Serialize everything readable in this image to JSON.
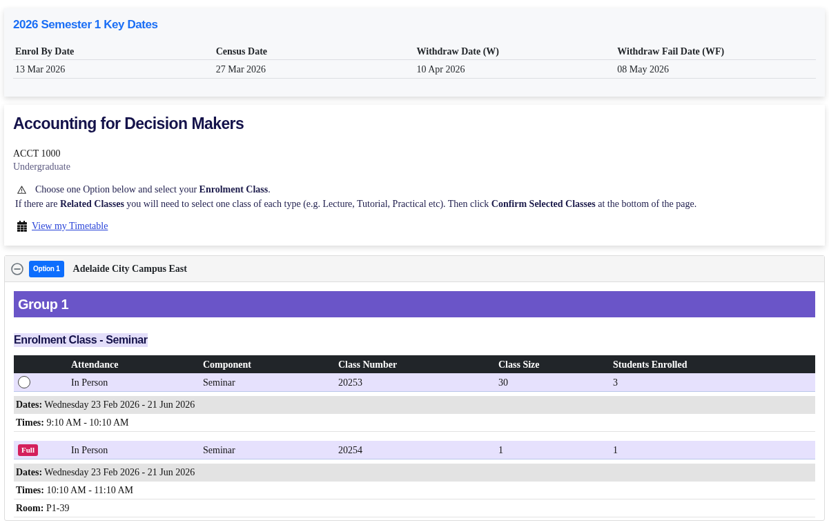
{
  "key_dates": {
    "title": "2026 Semester 1 Key Dates",
    "columns": [
      "Enrol By Date",
      "Census Date",
      "Withdraw Date (W)",
      "Withdraw Fail Date (WF)"
    ],
    "rows": [
      [
        "13 Mar 2026",
        "27 Mar 2026",
        "10 Apr 2026",
        "08 May 2026"
      ]
    ]
  },
  "course": {
    "title": "Accounting for Decision Makers",
    "code": "ACCT 1000",
    "level": "Undergraduate",
    "notice": [
      "Choose one Option below and select your **Enrolment Class**.",
      "If there are **Related Classes** you will need to select one class of each type (e.g. Lecture, Tutorial, Practical etc). Then click **Confirm Selected Classes** at the bottom of the page."
    ],
    "timetable_link": "View my Timetable"
  },
  "options": [
    {
      "label": "Option 1",
      "campus": "Adelaide City Campus East",
      "expanded": true,
      "groups": [
        {
          "title": "Group 1",
          "sections": [
            {
              "heading": "Enrolment Class - Seminar",
              "columns": [
                "Attendance",
                "Component",
                "Class Number",
                "Class Size",
                "Students Enrolled"
              ],
              "classes": [
                {
                  "kind": "radio",
                  "selected": false,
                  "cells": [
                    "In Person",
                    "Seminar",
                    "20253",
                    "30",
                    "3"
                  ],
                  "details": [
                    "**Dates:** Wednesday 23 Feb 2026 - 21 Jun 2026",
                    "**Times:** 9:10 AM - 10:10 AM"
                  ]
                },
                {
                  "kind": "full",
                  "badge": "Full",
                  "cells": [
                    "In Person",
                    "Seminar",
                    "20254",
                    "1",
                    "1"
                  ],
                  "details": [
                    "**Dates:** Wednesday 23 Feb 2026 - 21 Jun 2026",
                    "**Times:** 10:10 AM - 11:10 AM",
                    "**Room:** P1-39"
                  ]
                }
              ]
            }
          ]
        }
      ]
    }
  ]
}
